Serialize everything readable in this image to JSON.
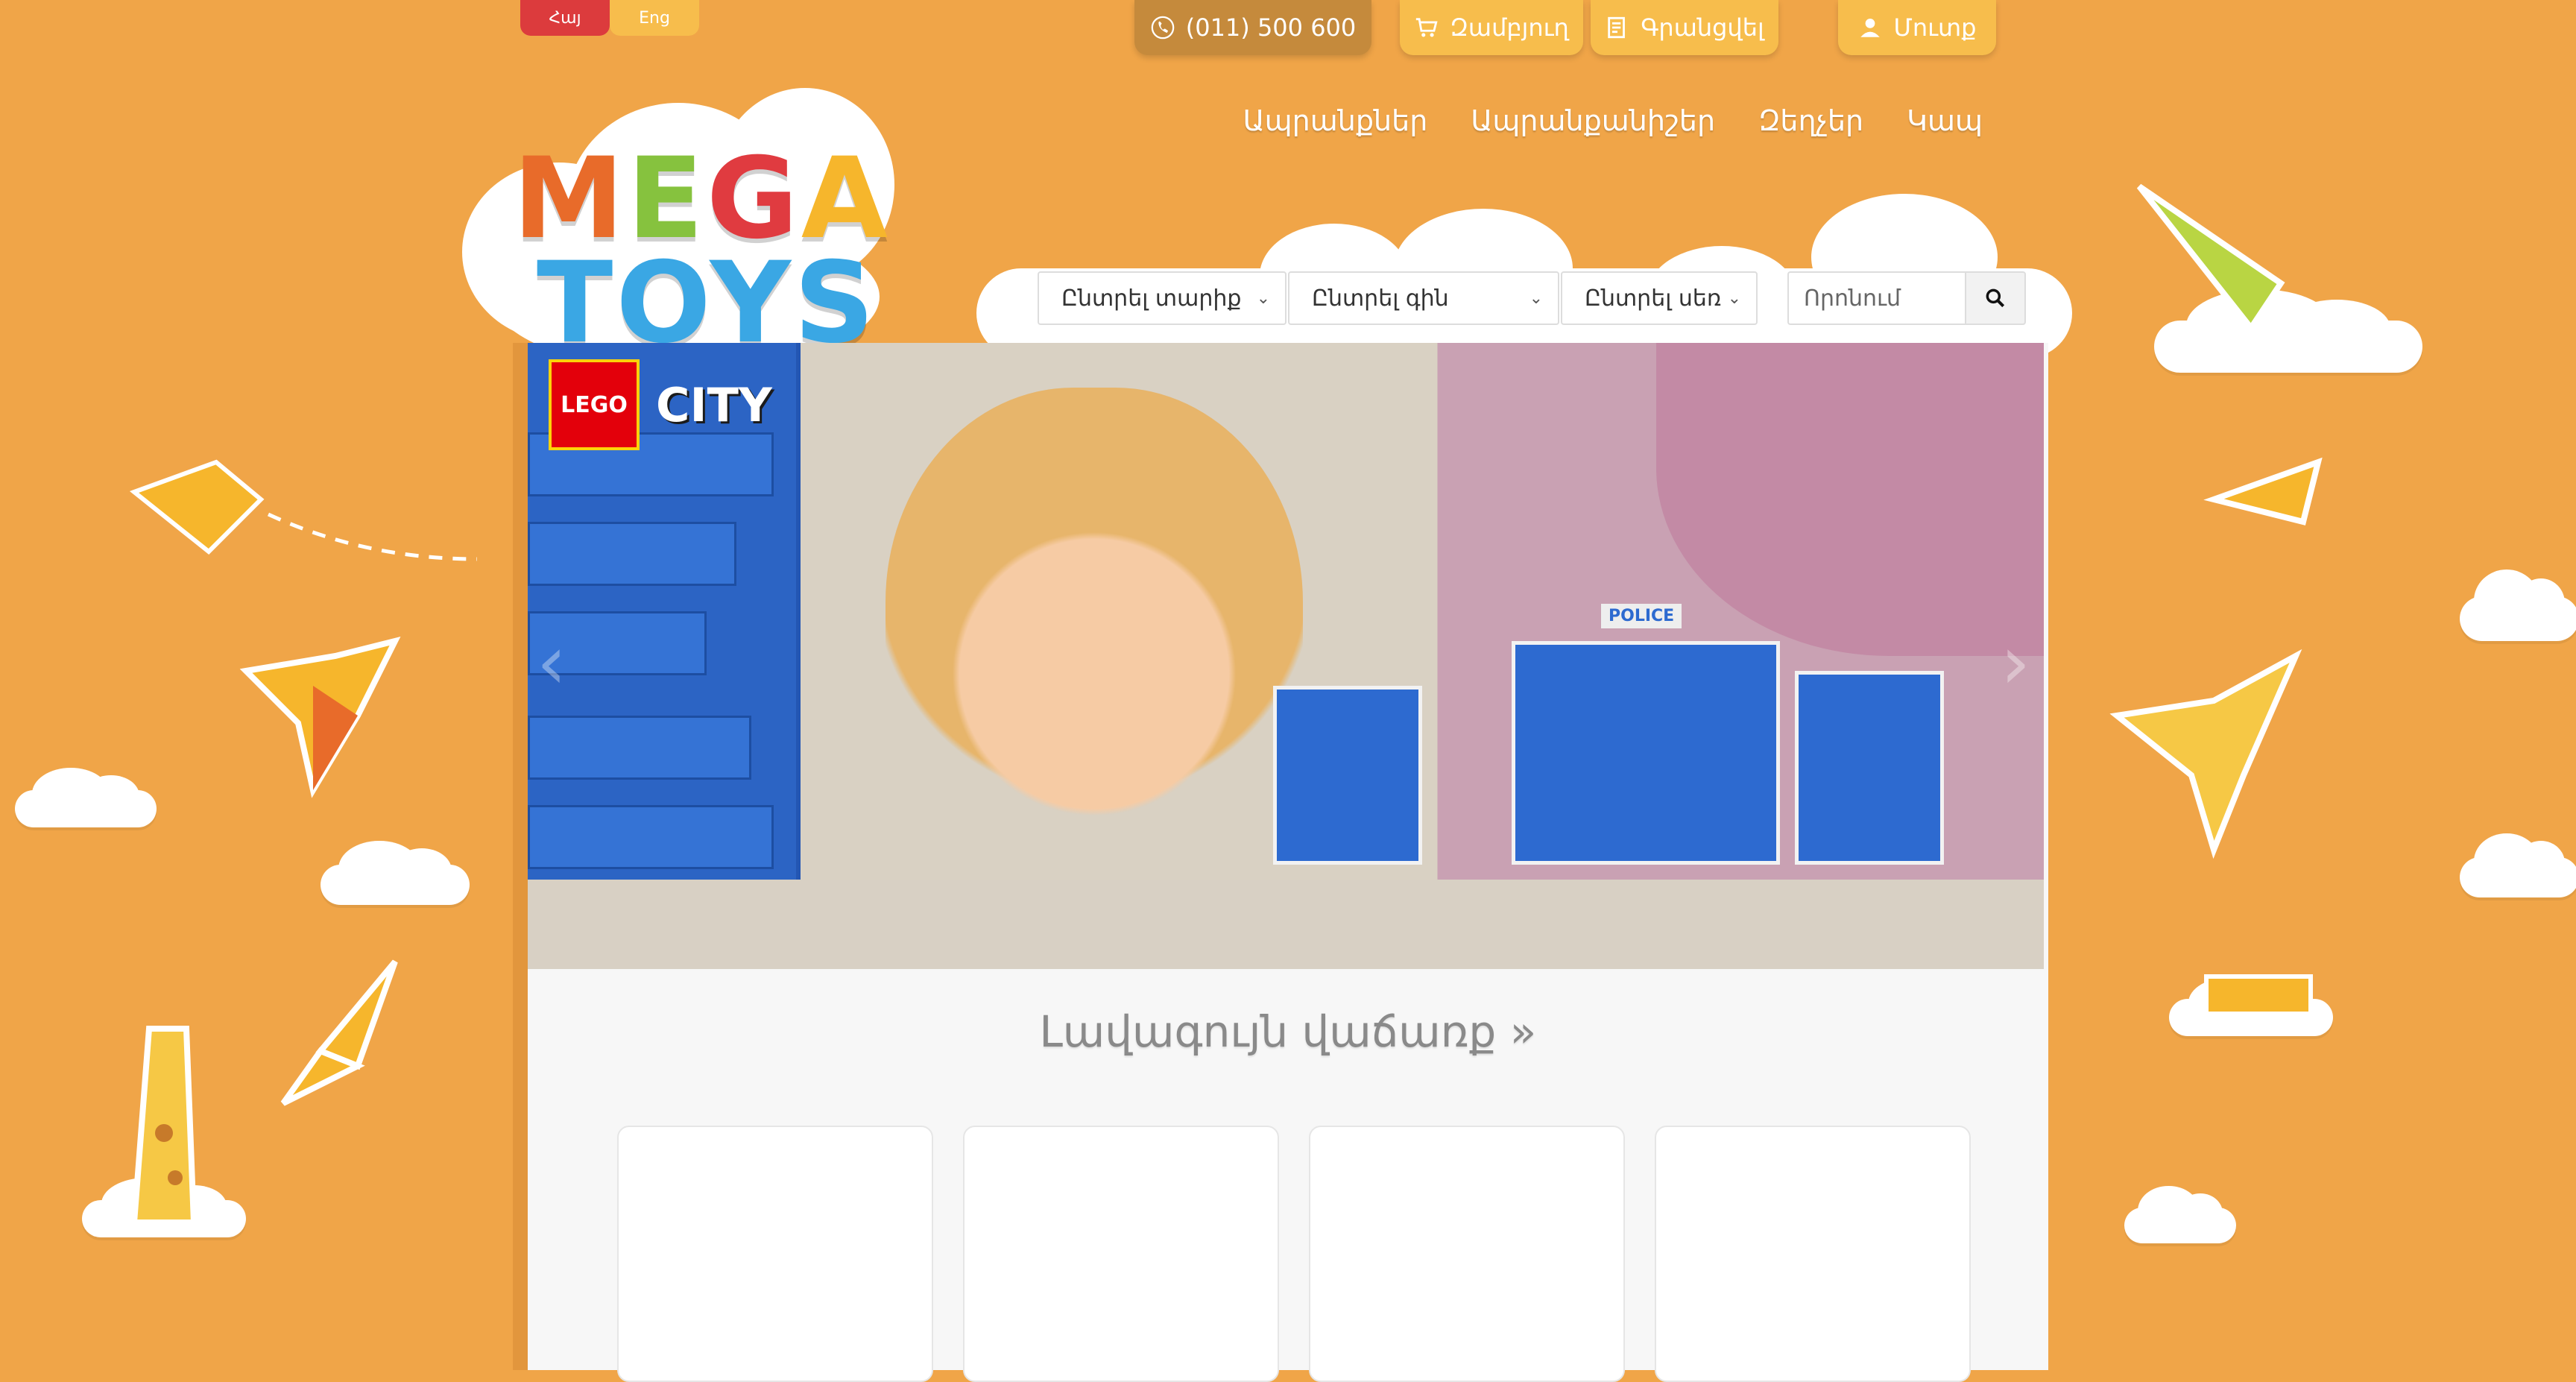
{
  "languages": {
    "hy": "Հայ",
    "en": "Eng"
  },
  "topbar": {
    "phone": "(011) 500 600",
    "cart": "Զամբյուղ",
    "register": "Գրանցվել",
    "login": "Մուտք"
  },
  "nav": {
    "items": [
      "Ապրանքներ",
      "Ապրանքանիշեր",
      "Զեղչեր",
      "Կապ"
    ]
  },
  "logo": {
    "line1": [
      "M",
      "E",
      "G",
      "A"
    ],
    "line2": "TOYS"
  },
  "filters": {
    "age": "Ընտրել տարիք",
    "price": "Ընտրել գին",
    "gender": "Ընտրել սեռ"
  },
  "search": {
    "placeholder": "Որոնում"
  },
  "banner": {
    "brand": "LEGO",
    "series": "CITY",
    "sign": "POLICE"
  },
  "main": {
    "section_title": "Լավագույն վաճառք »"
  },
  "colors": {
    "background": "#f0a548",
    "accent_red": "#dc3b3d",
    "accent_yellow": "#f7bd4c",
    "phone_bg": "#c58a3c"
  }
}
